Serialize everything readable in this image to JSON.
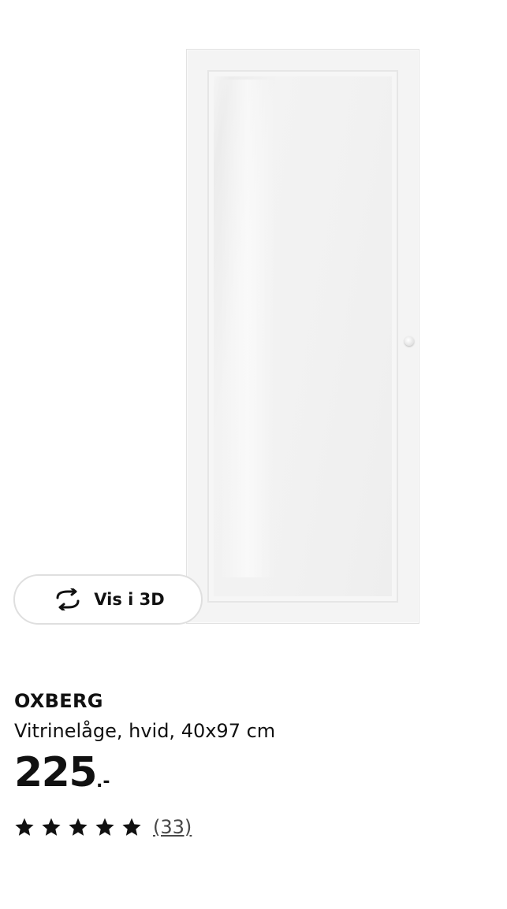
{
  "view3d": {
    "label": "Vis i 3D",
    "icon": "rotate-3d-icon"
  },
  "product": {
    "name": "OXBERG",
    "description": "Vitrinelåge, hvid, 40x97 cm",
    "price_integer": "225",
    "price_suffix": ".-"
  },
  "rating": {
    "stars_filled": 5,
    "stars_total": 5,
    "review_count_text": "(33)",
    "icon": "star-icon"
  },
  "colors": {
    "text": "#111111",
    "button_border": "#dfdfdf",
    "review_link": "#484848"
  }
}
